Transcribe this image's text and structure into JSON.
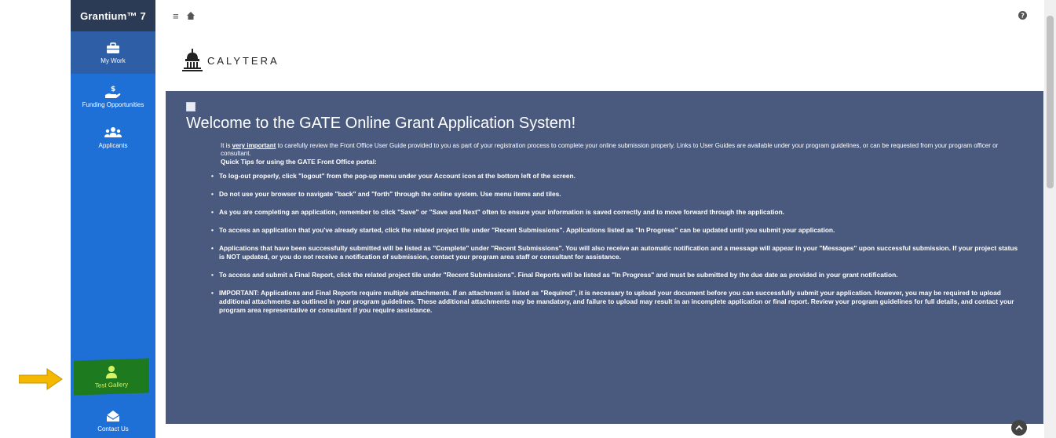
{
  "sidebar": {
    "brand": "Grantium™ 7",
    "items": [
      {
        "label": "My Work",
        "icon": "briefcase-icon"
      },
      {
        "label": "Funding Opportunities",
        "icon": "hand-dollar-icon"
      },
      {
        "label": "Applicants",
        "icon": "users-icon"
      }
    ],
    "bottom_items": [
      {
        "label": "Test Gallery",
        "icon": "user-icon"
      },
      {
        "label": "Contact Us",
        "icon": "envelope-icon"
      }
    ]
  },
  "topbar": {
    "menu_icon": "hamburger-icon",
    "home_icon": "home-icon",
    "help_icon": "help-icon"
  },
  "logo": {
    "text": "CALYTERA"
  },
  "welcome": {
    "title": "Welcome to the GATE Online Grant Application System!",
    "intro_before": "It is ",
    "intro_emphasis": "very important",
    "intro_after": " to carefully review the Front Office User Guide provided to you as part of your registration process to complete your online submission properly. Links to User Guides are available under your program guidelines, or can be requested from your program officer or consultant.",
    "tips_title": "Quick Tips for using the GATE Front Office portal:",
    "tips": [
      "To log-out properly, click \"logout\" from the pop-up menu under your Account icon at the bottom left of the screen.",
      "Do not use your browser to navigate \"back\" and \"forth\" through the online system. Use menu items and tiles.",
      "As you are completing an application, remember to click \"Save\" or \"Save and Next\" often to ensure your information is saved correctly and to move forward through the application.",
      "To access an application that you've already started, click the related project tile under \"Recent Submissions\". Applications listed as \"In Progress\" can be updated until you submit your application.",
      "Applications that have been successfully submitted will be listed as \"Complete\" under \"Recent Submissions\". You will also receive an automatic notification and a message will appear in your \"Messages\" upon successful submission. If your project status is NOT updated, or you do not receive a notification of submission, contact your program area staff or consultant for assistance.",
      "To access and submit a Final Report, click the related project tile under \"Recent Submissions\". Final Reports will be listed as \"In Progress\" and must be submitted by the due date as provided in your grant notification.",
      "IMPORTANT: Applications and Final Reports require multiple attachments. If an attachment is listed as \"Required\", it is necessary to upload your document before you can successfully submit your application. However, you may be required to upload additional attachments as outlined in your program guidelines. These additional attachments may be mandatory, and failure to upload may result in an incomplete application or final report. Review your program guidelines for full details, and contact your program area representative or consultant if you require assistance."
    ]
  },
  "colors": {
    "sidebar": "#1e6fd6",
    "brand_bar": "#2b3a55",
    "panel": "#4a5a7e",
    "highlight": "#1e7a1e",
    "arrow": "#f5b800"
  }
}
